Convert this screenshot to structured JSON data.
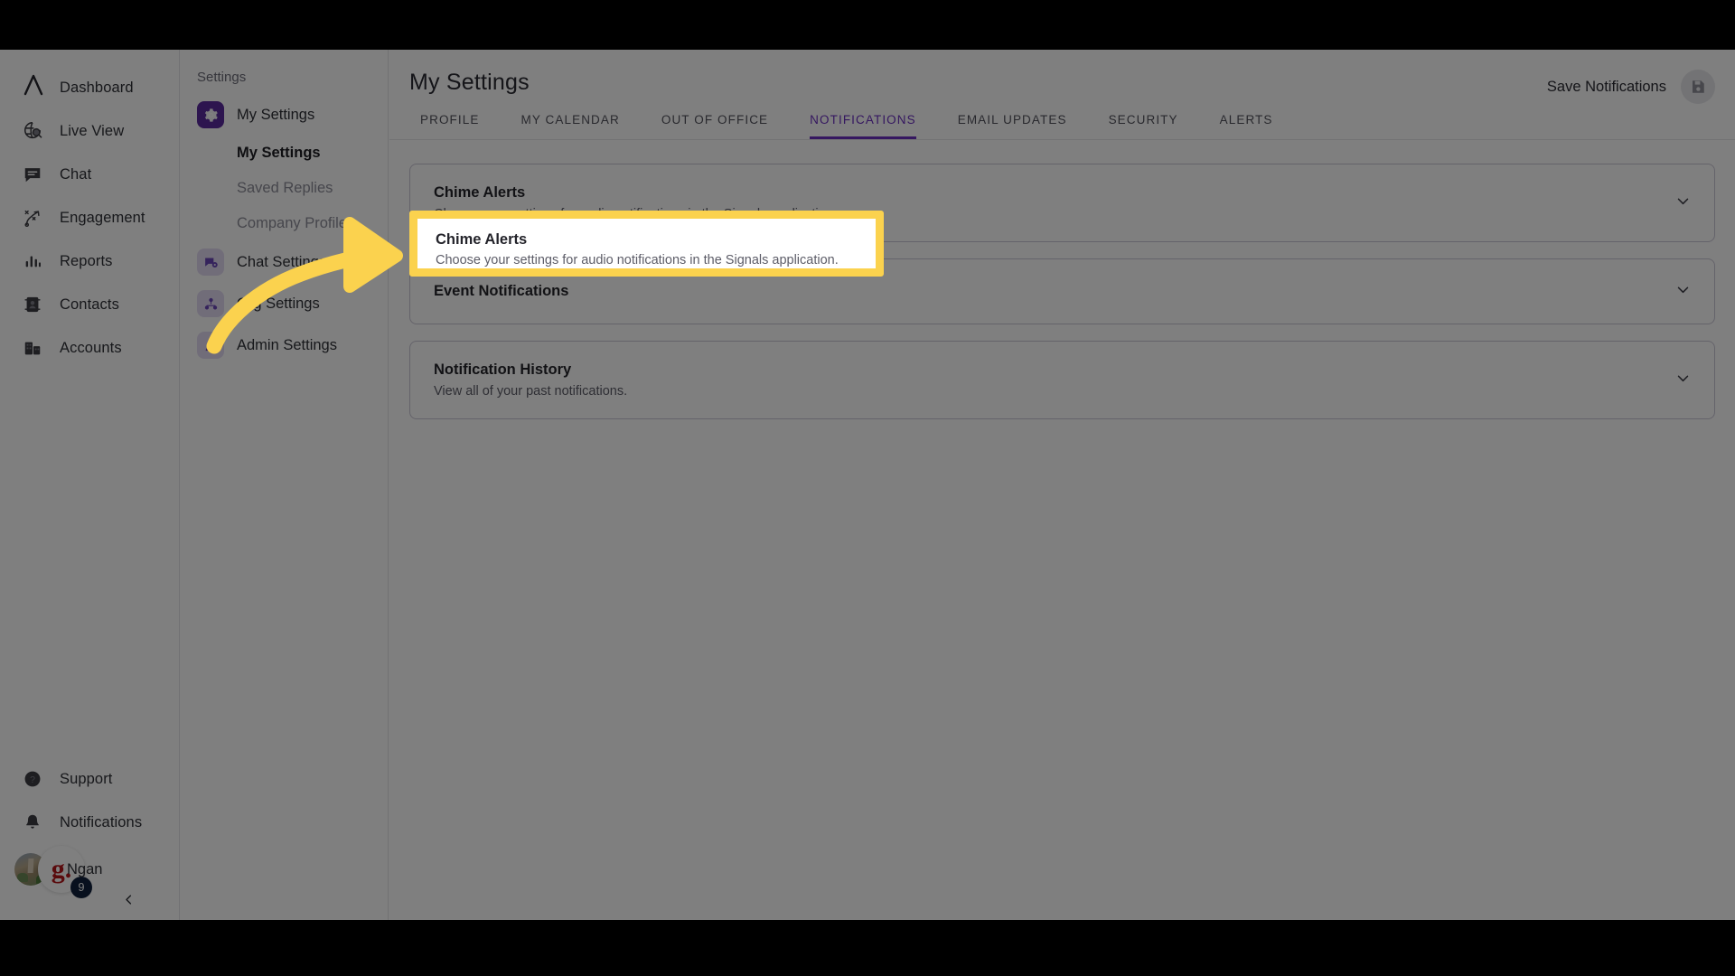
{
  "app": {
    "logo_icon": "lambda-logo-icon",
    "accent_purple": "#6b2fc0",
    "highlight_yellow": "#fbd24e",
    "dim_overlay": "rgba(0,0,0,0.5)"
  },
  "rail": {
    "items": [
      {
        "label": "Dashboard",
        "icon": "lambda-logo-icon"
      },
      {
        "label": "Live View",
        "icon": "globe-search-icon"
      },
      {
        "label": "Chat",
        "icon": "chat-bubble-icon"
      },
      {
        "label": "Engagement",
        "icon": "engagement-path-icon"
      },
      {
        "label": "Reports",
        "icon": "bar-chart-icon"
      },
      {
        "label": "Contacts",
        "icon": "contact-card-icon"
      },
      {
        "label": "Accounts",
        "icon": "building-icon"
      }
    ],
    "bottom": [
      {
        "label": "Support",
        "icon": "question-circle-icon"
      },
      {
        "label": "Notifications",
        "icon": "bell-icon"
      }
    ],
    "user": {
      "name": "Ngan",
      "badge_count": "9",
      "brand_mark": "g.",
      "avatar_icon": "user-avatar-photo"
    },
    "collapse_icon": "chevron-left-icon"
  },
  "settings_panel": {
    "title": "Settings",
    "items": [
      {
        "label": "My Settings",
        "icon": "gear-icon",
        "state": "active"
      },
      {
        "label": "Chat Settings",
        "icon": "chat-gear-icon",
        "state": "soft"
      },
      {
        "label": "Org Settings",
        "icon": "org-chart-icon",
        "state": "soft"
      },
      {
        "label": "Admin Settings",
        "icon": "admin-user-icon",
        "state": "soft"
      }
    ],
    "sub_items": [
      {
        "label": "My Settings",
        "state": "active"
      },
      {
        "label": "Saved Replies",
        "state": "muted"
      },
      {
        "label": "Company Profile",
        "state": "muted"
      }
    ]
  },
  "main": {
    "page_title": "My Settings",
    "save_label": "Save Notifications",
    "save_icon": "floppy-disk-save-icon",
    "tabs": [
      {
        "label": "PROFILE",
        "active": false
      },
      {
        "label": "MY CALENDAR",
        "active": false
      },
      {
        "label": "OUT OF OFFICE",
        "active": false
      },
      {
        "label": "NOTIFICATIONS",
        "active": true
      },
      {
        "label": "EMAIL UPDATES",
        "active": false
      },
      {
        "label": "SECURITY",
        "active": false
      },
      {
        "label": "ALERTS",
        "active": false
      }
    ],
    "cards": [
      {
        "title": "Chime Alerts",
        "desc": "Choose your settings for audio notifications in the Signals application.",
        "chevron": "chevron-down-icon"
      },
      {
        "title": "Event Notifications",
        "desc": "",
        "chevron": "chevron-down-icon"
      },
      {
        "title": "Notification History",
        "desc": "View all of your past notifications.",
        "chevron": "chevron-down-icon"
      }
    ]
  },
  "annotation": {
    "arrow_icon": "curved-arrow-pointing-right",
    "arrow_color": "#fbd24e",
    "highlight_target": "Chime Alerts"
  }
}
